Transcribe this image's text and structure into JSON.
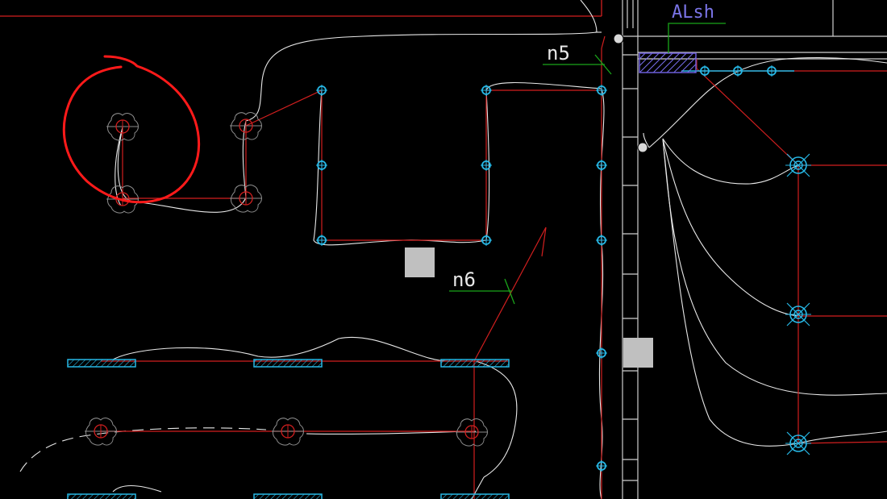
{
  "drawing": {
    "background": "#000000",
    "colors": {
      "wire": "#e8e8e8",
      "circuit": "#d21f1f",
      "device": "#27b8e6",
      "leader": "#1aa51a",
      "panel_label": "#7a74e6",
      "panel_hatch": "#6a5cd6",
      "markup": "#ff1a1a",
      "box": "#c0c0c0"
    },
    "labels": {
      "n5": "n5",
      "n6": "n6",
      "panel": "ALsh"
    }
  }
}
